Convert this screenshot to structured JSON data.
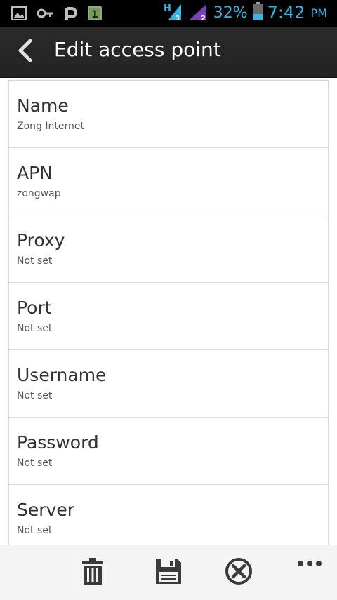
{
  "status_bar": {
    "icons_left": [
      "image-icon",
      "key-icon",
      "p-icon",
      "sim-1-icon"
    ],
    "network_icons": [
      "h-signal-1-icon",
      "signal-2-icon"
    ],
    "battery_percent": "32%",
    "time": "7:42",
    "ampm": "PM",
    "accent_color": "#33b5e5"
  },
  "action_bar": {
    "title": "Edit access point"
  },
  "fields": [
    {
      "label": "Name",
      "value": "Zong Internet"
    },
    {
      "label": "APN",
      "value": "zongwap"
    },
    {
      "label": "Proxy",
      "value": "Not set"
    },
    {
      "label": "Port",
      "value": "Not set"
    },
    {
      "label": "Username",
      "value": "Not set"
    },
    {
      "label": "Password",
      "value": "Not set"
    },
    {
      "label": "Server",
      "value": "Not set"
    }
  ],
  "bottom_bar": {
    "actions": [
      "delete-icon",
      "save-icon",
      "cancel-icon",
      "overflow-menu-icon"
    ]
  }
}
